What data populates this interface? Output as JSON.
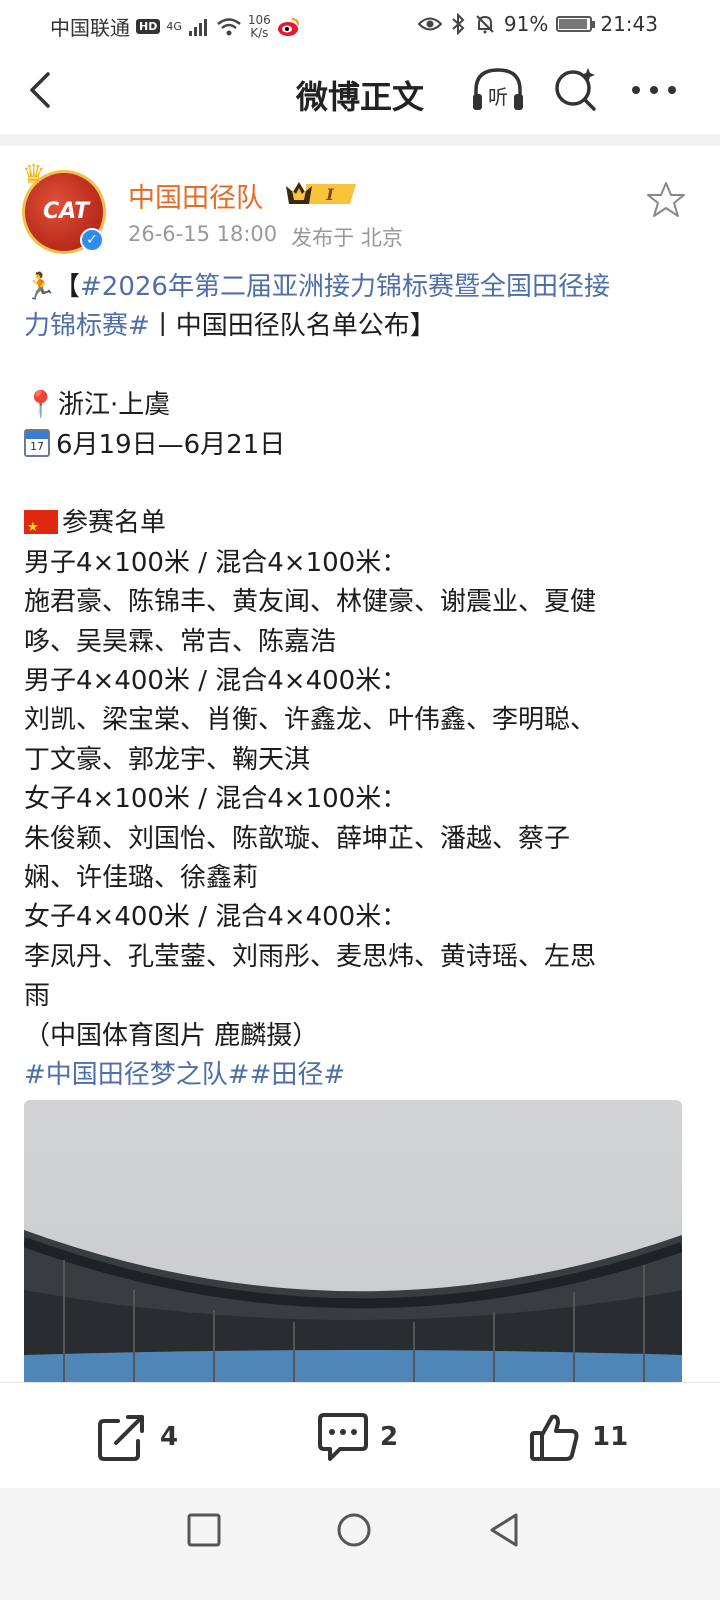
{
  "status_bar": {
    "carrier": "中国联通",
    "hd": "HD",
    "network": "4G",
    "speed_value": "106",
    "speed_unit": "K/s",
    "battery": "91%",
    "battery_level": 0.91,
    "time": "21:43"
  },
  "header": {
    "title": "微博正文",
    "listen_label": "听"
  },
  "author": {
    "name": "中国田径队",
    "avatar_text": "CAT",
    "vip_level": "I",
    "timestamp": "26-6-15 18:00",
    "location": "发布于 北京"
  },
  "post": {
    "runner_emoji": "🏃",
    "title_open": "【",
    "title_tag_1": "#2026年第二届亚洲接力锦标赛暨全国田径接",
    "title_tag_2": "力锦标赛#",
    "title_rest": "丨中国田径队名单公布】",
    "location": "浙江·上虞",
    "calendar_label": "17",
    "dates": "6月19日—6月21日",
    "roster_heading": "参赛名单",
    "lines": [
      "男子4×100米 / 混合4×100米：",
      "施君豪、陈锦丰、黄友闻、林健豪、谢震业、夏健",
      "哆、吴昊霖、常吉、陈嘉浩",
      "男子4×400米 / 混合4×400米：",
      "刘凯、梁宝棠、肖衡、许鑫龙、叶伟鑫、李明聪、",
      "丁文豪、郭龙宇、鞠天淇",
      "女子4×100米 / 混合4×100米：",
      "朱俊颖、刘国怡、陈歆璇、薛坤芷、潘越、蔡子",
      "娴、许佳璐、徐鑫莉",
      "女子4×400米 / 混合4×400米：",
      "李凤丹、孔莹蓥、刘雨彤、麦思炜、黄诗瑶、左思",
      "雨",
      "（中国体育图片 鹿麟摄）"
    ],
    "footer_tags": "#中国田径梦之队##田径#"
  },
  "actions": {
    "repost_count": "4",
    "comment_count": "2",
    "like_count": "11"
  },
  "colors": {
    "author_name": "#e86b24",
    "hashtag": "#4f6fa8",
    "meta": "#999999"
  }
}
